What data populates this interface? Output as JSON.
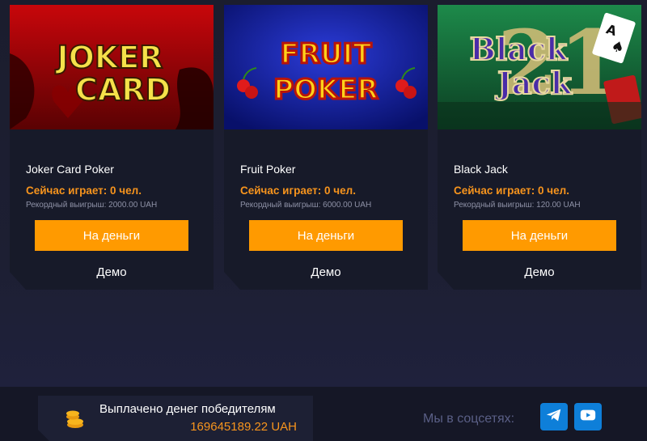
{
  "games": [
    {
      "title": "Joker Card Poker",
      "image_text": [
        "JOKER",
        "CARD"
      ],
      "playing_prefix": "Сейчас играет:",
      "playing_count": "0 чел.",
      "record": "Рекордный выигрыш: 2000.00 UAH",
      "money_button": "На деньги",
      "demo_button": "Демо"
    },
    {
      "title": "Fruit Poker",
      "image_text": [
        "FRUIT",
        "POKER"
      ],
      "playing_prefix": "Сейчас играет:",
      "playing_count": "0 чел.",
      "record": "Рекордный выигрыш: 6000.00 UAH",
      "money_button": "На деньги",
      "demo_button": "Демо"
    },
    {
      "title": "Black Jack",
      "image_text": [
        "Black",
        "Jack",
        "21"
      ],
      "playing_prefix": "Сейчас играет:",
      "playing_count": "0 чел.",
      "record": "Рекордный выигрыш: 120.00 UAH",
      "money_button": "На деньги",
      "demo_button": "Демо"
    }
  ],
  "footer": {
    "payout_label": "Выплачено денег победителям",
    "payout_amount": "169645189.22 UAH",
    "social_label": "Мы в соцсетях:",
    "social": [
      {
        "name": "telegram",
        "icon": "telegram-icon"
      },
      {
        "name": "youtube",
        "icon": "youtube-icon"
      }
    ]
  },
  "colors": {
    "accent": "#ff9a00",
    "highlight_text": "#f7941d",
    "card_bg": "#171a29",
    "social_bg": "#0e7fd9"
  }
}
